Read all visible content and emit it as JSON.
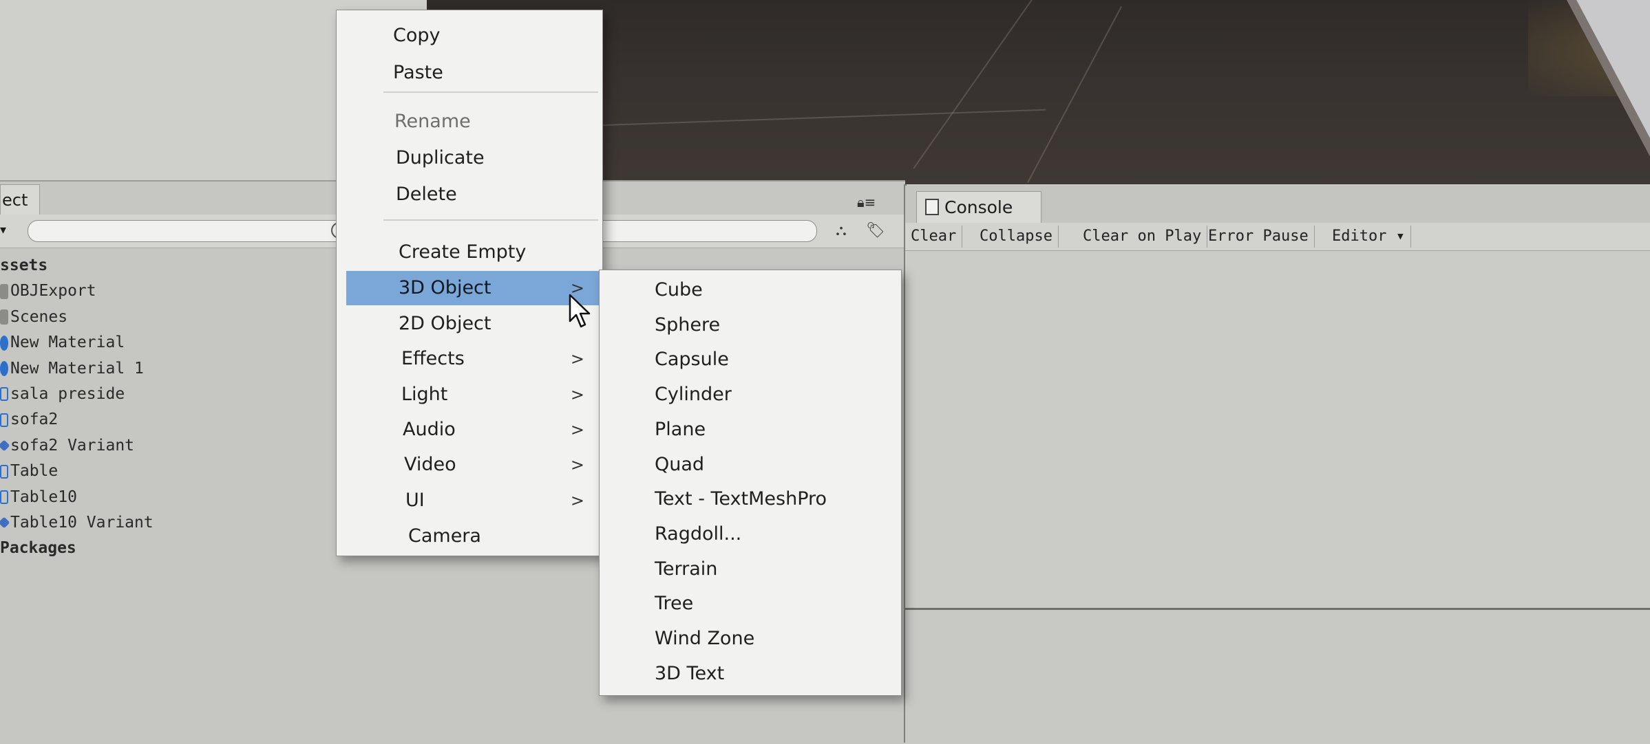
{
  "project": {
    "tab_label": "ect",
    "create_label": "▾",
    "tree": [
      {
        "label": "ssets",
        "kind": "header"
      },
      {
        "label": "OBJExport",
        "kind": "folder"
      },
      {
        "label": "Scenes",
        "kind": "folder"
      },
      {
        "label": "New Material",
        "kind": "material"
      },
      {
        "label": "New Material 1",
        "kind": "material"
      },
      {
        "label": "sala preside",
        "kind": "prefab"
      },
      {
        "label": "sofa2",
        "kind": "prefab"
      },
      {
        "label": "sofa2 Variant",
        "kind": "variant"
      },
      {
        "label": "Table",
        "kind": "prefab"
      },
      {
        "label": "Table10",
        "kind": "prefab"
      },
      {
        "label": "Table10 Variant",
        "kind": "variant"
      },
      {
        "label": "Packages",
        "kind": "header"
      }
    ]
  },
  "console": {
    "tab_label": "Console",
    "buttons": [
      "Clear",
      "Collapse",
      "Clear on Play",
      "Error Pause",
      "Editor ▾"
    ]
  },
  "context_menu": {
    "items": [
      {
        "label": "Copy",
        "state": "normal"
      },
      {
        "label": "Paste",
        "state": "normal"
      },
      {
        "label": "Rename",
        "state": "disabled"
      },
      {
        "label": "Duplicate",
        "state": "normal"
      },
      {
        "label": "Delete",
        "state": "normal"
      },
      {
        "label": "Create Empty",
        "state": "normal"
      },
      {
        "label": "3D Object",
        "state": "highlight",
        "submenu": true
      },
      {
        "label": "2D Object",
        "state": "normal"
      },
      {
        "label": "Effects",
        "state": "normal",
        "submenu": true
      },
      {
        "label": "Light",
        "state": "normal",
        "submenu": true
      },
      {
        "label": "Audio",
        "state": "normal",
        "submenu": true
      },
      {
        "label": "Video",
        "state": "normal",
        "submenu": true
      },
      {
        "label": "UI",
        "state": "normal",
        "submenu": true
      },
      {
        "label": "Camera",
        "state": "normal"
      }
    ],
    "submenu_arrow": ">"
  },
  "submenu_3d": {
    "items": [
      "Cube",
      "Sphere",
      "Capsule",
      "Cylinder",
      "Plane",
      "Quad",
      "Text - TextMeshPro",
      "Ragdoll...",
      "Terrain",
      "Tree",
      "Wind Zone",
      "3D Text"
    ]
  },
  "colors": {
    "highlight": "#7aa7d8",
    "material_icon": "#2d6fc9"
  },
  "icons": [
    "lock-icon",
    "menu-icon",
    "filter-by-type-icon",
    "filter-by-label-icon",
    "search-icon",
    "console-doc-icon",
    "mouse-cursor-icon"
  ]
}
